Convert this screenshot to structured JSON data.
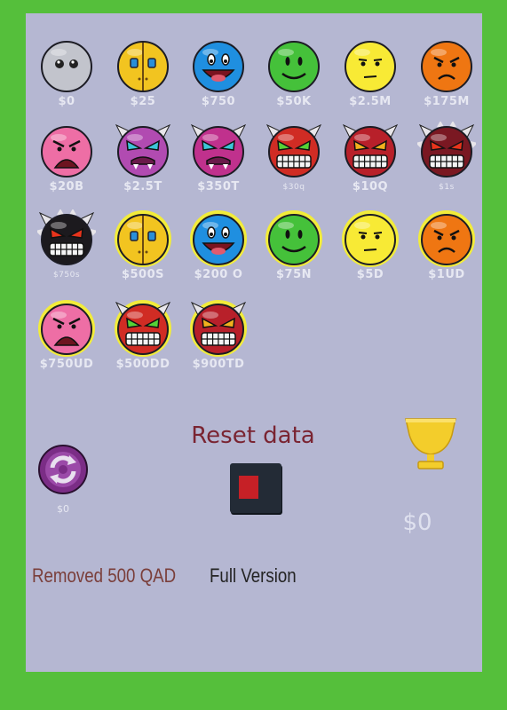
{
  "shop": {
    "items": [
      {
        "price": "$0",
        "face": "gray"
      },
      {
        "price": "$25",
        "face": "auto"
      },
      {
        "price": "$750",
        "face": "easy"
      },
      {
        "price": "$50K",
        "face": "normal"
      },
      {
        "price": "$2.5M",
        "face": "hard"
      },
      {
        "price": "$175M",
        "face": "harder"
      },
      {
        "price": "$20B",
        "face": "insane"
      },
      {
        "price": "$2.5T",
        "face": "demon-easy"
      },
      {
        "price": "$350T",
        "face": "demon-medium"
      },
      {
        "price": "$30q",
        "face": "demon-hard"
      },
      {
        "price": "$10Q",
        "face": "demon-insane"
      },
      {
        "price": "$1s",
        "face": "demon-extreme"
      },
      {
        "price": "$750s",
        "face": "demon-black"
      },
      {
        "price": "$500S",
        "face": "auto-glow"
      },
      {
        "price": "$200 O",
        "face": "easy-glow"
      },
      {
        "price": "$75N",
        "face": "normal-glow"
      },
      {
        "price": "$5D",
        "face": "hard-glow"
      },
      {
        "price": "$1UD",
        "face": "harder-glow"
      },
      {
        "price": "$750UD",
        "face": "insane-glow"
      },
      {
        "price": "$500DD",
        "face": "demon-hard-glow"
      },
      {
        "price": "$900TD",
        "face": "demon-insane-glow"
      }
    ]
  },
  "reset": {
    "title": "Reset data"
  },
  "cycle": {
    "price": "$0"
  },
  "total": {
    "value": "$0"
  },
  "links": {
    "removed": "Removed 500 QAD",
    "full_version": "Full Version"
  }
}
